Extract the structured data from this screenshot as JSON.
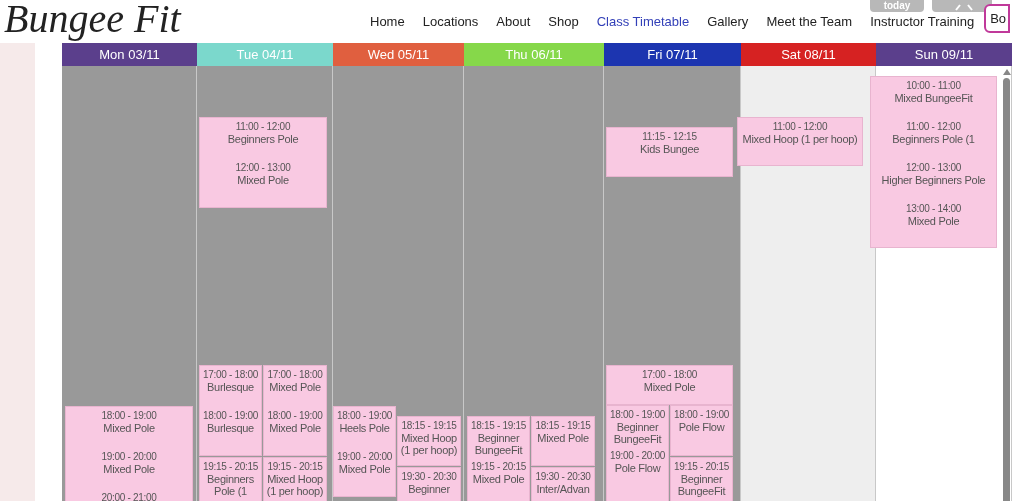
{
  "header": {
    "logo": "Bungee Fit",
    "nav": [
      {
        "label": "Home",
        "selected": false
      },
      {
        "label": "Locations",
        "selected": false
      },
      {
        "label": "About",
        "selected": false
      },
      {
        "label": "Shop",
        "selected": false
      },
      {
        "label": "Class Timetable",
        "selected": true
      },
      {
        "label": "Gallery",
        "selected": false
      },
      {
        "label": "Meet the Team",
        "selected": false
      },
      {
        "label": "Instructor Training",
        "selected": false
      }
    ],
    "book_button": "Bo",
    "today_button": "today"
  },
  "days": [
    {
      "label": "Mon 03/11",
      "color": "#5b3f8c",
      "kind": "past",
      "blocks": [
        {
          "entries": [
            {
              "time": "18:00 - 19:00",
              "name": "Mixed Pole"
            },
            {
              "time": "19:00 - 20:00",
              "name": "Mixed Pole"
            },
            {
              "time": "20:00 - 21:00"
            }
          ]
        }
      ]
    },
    {
      "label": "Tue 04/11",
      "color": "#7bd8cc",
      "kind": "past",
      "blocks": [
        {
          "entries": [
            {
              "time": "11:00 - 12:00",
              "name": "Beginners Pole"
            },
            {
              "time": "12:00 - 13:00",
              "name": "Mixed Pole"
            }
          ]
        },
        {
          "entries": [
            {
              "time": "17:00 - 18:00",
              "name": "Burlesque"
            },
            {
              "time": "18:00 - 19:00",
              "name": "Burlesque"
            }
          ]
        },
        {
          "entries": [
            {
              "time": "17:00 - 18:00",
              "name": "Mixed Pole"
            },
            {
              "time": "18:00 - 19:00",
              "name": "Mixed Pole"
            }
          ]
        },
        {
          "entries": [
            {
              "time": "19:15 - 20:15",
              "name": "Beginners Pole (1"
            }
          ]
        },
        {
          "entries": [
            {
              "time": "19:15 - 20:15",
              "name": "Mixed Hoop (1 per hoop)"
            }
          ]
        }
      ]
    },
    {
      "label": "Wed 05/11",
      "color": "#e05f3f",
      "kind": "past",
      "blocks": [
        {
          "entries": [
            {
              "time": "18:00 - 19:00",
              "name": "Heels Pole"
            },
            {
              "time": "19:00 - 20:00",
              "name": "Mixed Pole"
            }
          ]
        },
        {
          "entries": [
            {
              "time": "18:15 - 19:15",
              "name": "Mixed Hoop (1 per hoop)"
            }
          ]
        },
        {
          "entries": [
            {
              "time": "19:30 - 20:30",
              "name": "Beginner"
            }
          ]
        }
      ]
    },
    {
      "label": "Thu 06/11",
      "color": "#86d84a",
      "kind": "past",
      "blocks": [
        {
          "entries": [
            {
              "time": "18:15 - 19:15",
              "name": "Beginner BungeeFit"
            },
            {
              "time": "19:15 - 20:15",
              "name": "Mixed Pole"
            }
          ]
        },
        {
          "entries": [
            {
              "time": "18:15 - 19:15",
              "name": "Mixed Pole"
            }
          ]
        },
        {
          "entries": [
            {
              "time": "19:30 - 20:30",
              "name": "Inter/Advan"
            }
          ]
        }
      ]
    },
    {
      "label": "Fri 07/11",
      "color": "#1c35b0",
      "kind": "past",
      "blocks": [
        {
          "entries": [
            {
              "time": "11:15 - 12:15",
              "name": "Kids Bungee"
            }
          ]
        },
        {
          "entries": [
            {
              "time": "17:00 - 18:00",
              "name": "Mixed Pole"
            }
          ]
        },
        {
          "entries": [
            {
              "time": "18:00 - 19:00",
              "name": "Beginner BungeeFit"
            },
            {
              "time": "19:00 - 20:00",
              "name": "Pole Flow"
            }
          ]
        },
        {
          "entries": [
            {
              "time": "18:00 - 19:00",
              "name": "Pole Flow"
            }
          ]
        },
        {
          "entries": [
            {
              "time": "19:15 - 20:15",
              "name": "Beginner BungeeFit"
            }
          ]
        }
      ]
    },
    {
      "label": "Sat 08/11",
      "color": "#d62222",
      "kind": "today",
      "blocks": [
        {
          "entries": [
            {
              "time": "11:00 - 12:00",
              "name": "Mixed Hoop (1 per hoop)"
            }
          ]
        }
      ]
    },
    {
      "label": "Sun 09/11",
      "color": "#5b3f8c",
      "kind": "upcoming",
      "blocks": [
        {
          "entries": [
            {
              "time": "10:00 - 11:00",
              "name": "Mixed BungeeFit"
            },
            {
              "time": "11:00 - 12:00",
              "name": "Beginners Pole (1"
            },
            {
              "time": "12:00 - 13:00",
              "name": "Higher Beginners Pole"
            },
            {
              "time": "13:00 - 14:00",
              "name": "Mixed Pole"
            }
          ]
        }
      ]
    }
  ]
}
